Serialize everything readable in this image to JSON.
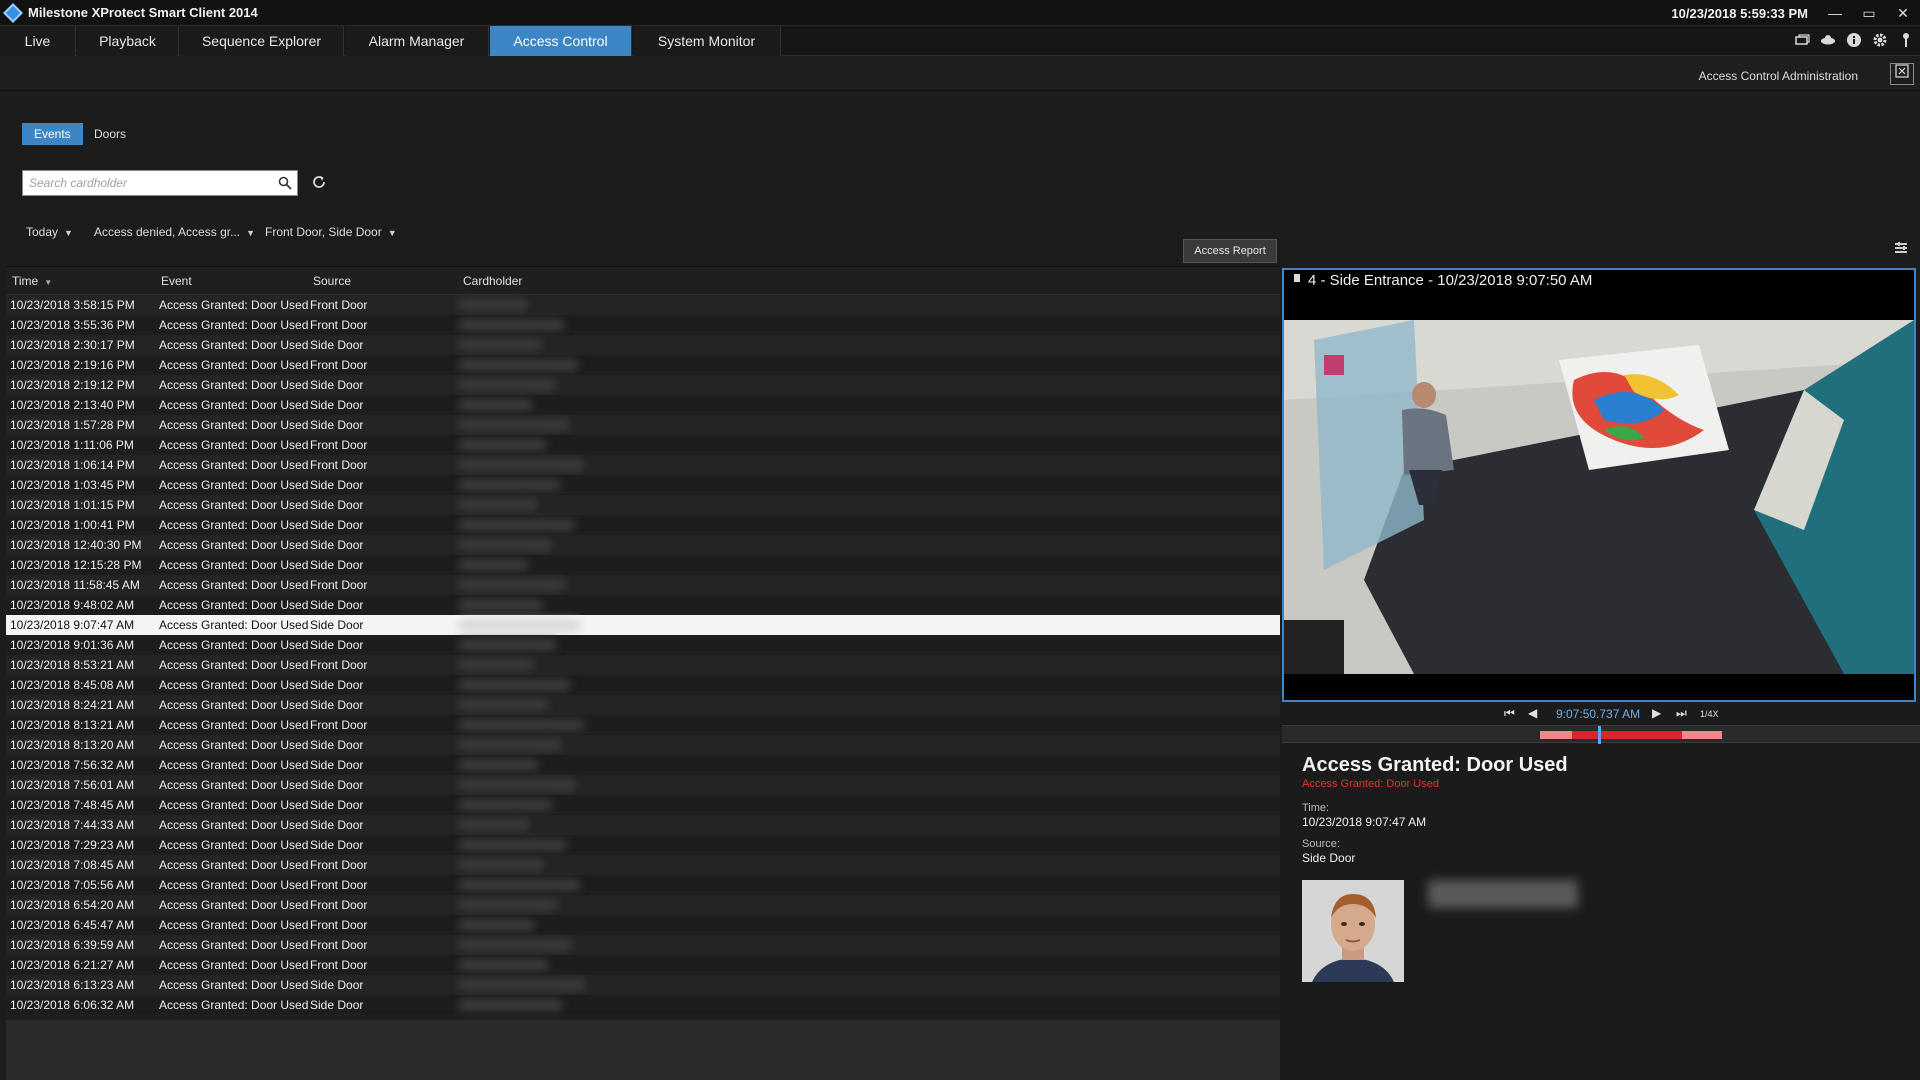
{
  "app": {
    "title": "Milestone XProtect Smart Client 2014",
    "clock": "10/23/2018 5:59:33 PM"
  },
  "window_controls": {
    "minimize": "—",
    "maximize": "▭",
    "close": "✕"
  },
  "main_tabs": [
    {
      "label": "Live",
      "active": false
    },
    {
      "label": "Playback",
      "active": false
    },
    {
      "label": "Sequence Explorer",
      "active": false
    },
    {
      "label": "Alarm Manager",
      "active": false
    },
    {
      "label": "Access Control",
      "active": true
    },
    {
      "label": "System Monitor",
      "active": false
    }
  ],
  "toolbar_icons": [
    "window-icon",
    "cloud-icon",
    "info-icon",
    "gear-icon",
    "pin-icon"
  ],
  "header": {
    "admin_label": "Access Control Administration"
  },
  "sub_tabs": [
    {
      "label": "Events",
      "active": true
    },
    {
      "label": "Doors",
      "active": false
    }
  ],
  "search": {
    "placeholder": "Search cardholder",
    "value": ""
  },
  "filters": [
    {
      "label": "Today"
    },
    {
      "label": "Access denied, Access gr..."
    },
    {
      "label": "Front Door, Side Door"
    }
  ],
  "report_button": "Access Report",
  "table": {
    "columns": [
      "Time",
      "Event",
      "Source",
      "Cardholder"
    ],
    "rows": [
      {
        "time": "10/23/2018 3:58:15 PM",
        "event": "Access Granted: Door Used",
        "source": "Front Door"
      },
      {
        "time": "10/23/2018 3:55:36 PM",
        "event": "Access Granted: Door Used",
        "source": "Front Door"
      },
      {
        "time": "10/23/2018 2:30:17 PM",
        "event": "Access Granted: Door Used",
        "source": "Side Door"
      },
      {
        "time": "10/23/2018 2:19:16 PM",
        "event": "Access Granted: Door Used",
        "source": "Front Door"
      },
      {
        "time": "10/23/2018 2:19:12 PM",
        "event": "Access Granted: Door Used",
        "source": "Side Door"
      },
      {
        "time": "10/23/2018 2:13:40 PM",
        "event": "Access Granted: Door Used",
        "source": "Side Door"
      },
      {
        "time": "10/23/2018 1:57:28 PM",
        "event": "Access Granted: Door Used",
        "source": "Side Door"
      },
      {
        "time": "10/23/2018 1:11:06 PM",
        "event": "Access Granted: Door Used",
        "source": "Front Door"
      },
      {
        "time": "10/23/2018 1:06:14 PM",
        "event": "Access Granted: Door Used",
        "source": "Front Door"
      },
      {
        "time": "10/23/2018 1:03:45 PM",
        "event": "Access Granted: Door Used",
        "source": "Side Door"
      },
      {
        "time": "10/23/2018 1:01:15 PM",
        "event": "Access Granted: Door Used",
        "source": "Side Door"
      },
      {
        "time": "10/23/2018 1:00:41 PM",
        "event": "Access Granted: Door Used",
        "source": "Side Door"
      },
      {
        "time": "10/23/2018 12:40:30 PM",
        "event": "Access Granted: Door Used",
        "source": "Side Door"
      },
      {
        "time": "10/23/2018 12:15:28 PM",
        "event": "Access Granted: Door Used",
        "source": "Side Door"
      },
      {
        "time": "10/23/2018 11:58:45 AM",
        "event": "Access Granted: Door Used",
        "source": "Front Door"
      },
      {
        "time": "10/23/2018 9:48:02 AM",
        "event": "Access Granted: Door Used",
        "source": "Side Door"
      },
      {
        "time": "10/23/2018 9:07:47 AM",
        "event": "Access Granted: Door Used",
        "source": "Side Door",
        "selected": true
      },
      {
        "time": "10/23/2018 9:01:36 AM",
        "event": "Access Granted: Door Used",
        "source": "Side Door"
      },
      {
        "time": "10/23/2018 8:53:21 AM",
        "event": "Access Granted: Door Used",
        "source": "Front Door"
      },
      {
        "time": "10/23/2018 8:45:08 AM",
        "event": "Access Granted: Door Used",
        "source": "Side Door"
      },
      {
        "time": "10/23/2018 8:24:21 AM",
        "event": "Access Granted: Door Used",
        "source": "Side Door"
      },
      {
        "time": "10/23/2018 8:13:21 AM",
        "event": "Access Granted: Door Used",
        "source": "Front Door"
      },
      {
        "time": "10/23/2018 8:13:20 AM",
        "event": "Access Granted: Door Used",
        "source": "Side Door"
      },
      {
        "time": "10/23/2018 7:56:32 AM",
        "event": "Access Granted: Door Used",
        "source": "Side Door"
      },
      {
        "time": "10/23/2018 7:56:01 AM",
        "event": "Access Granted: Door Used",
        "source": "Side Door"
      },
      {
        "time": "10/23/2018 7:48:45 AM",
        "event": "Access Granted: Door Used",
        "source": "Side Door"
      },
      {
        "time": "10/23/2018 7:44:33 AM",
        "event": "Access Granted: Door Used",
        "source": "Side Door"
      },
      {
        "time": "10/23/2018 7:29:23 AM",
        "event": "Access Granted: Door Used",
        "source": "Side Door"
      },
      {
        "time": "10/23/2018 7:08:45 AM",
        "event": "Access Granted: Door Used",
        "source": "Front Door"
      },
      {
        "time": "10/23/2018 7:05:56 AM",
        "event": "Access Granted: Door Used",
        "source": "Front Door"
      },
      {
        "time": "10/23/2018 6:54:20 AM",
        "event": "Access Granted: Door Used",
        "source": "Front Door"
      },
      {
        "time": "10/23/2018 6:45:47 AM",
        "event": "Access Granted: Door Used",
        "source": "Front Door"
      },
      {
        "time": "10/23/2018 6:39:59 AM",
        "event": "Access Granted: Door Used",
        "source": "Front Door"
      },
      {
        "time": "10/23/2018 6:21:27 AM",
        "event": "Access Granted: Door Used",
        "source": "Front Door"
      },
      {
        "time": "10/23/2018 6:13:23 AM",
        "event": "Access Granted: Door Used",
        "source": "Side Door"
      },
      {
        "time": "10/23/2018 6:06:32 AM",
        "event": "Access Granted: Door Used",
        "source": "Side Door"
      }
    ]
  },
  "video": {
    "title": "4 - Side Entrance - 10/23/2018 9:07:50 AM",
    "playback_time": "9:07:50.737 AM",
    "speed_label": "1/4X"
  },
  "details": {
    "title": "Access Granted: Door Used",
    "subtitle": "Access Granted: Door Used",
    "time_label": "Time:",
    "time_value": "10/23/2018 9:07:47 AM",
    "source_label": "Source:",
    "source_value": "Side Door"
  },
  "colors": {
    "accent": "#3d86c6",
    "alert_red": "#e0352b",
    "timeline_red": "#d8262e"
  }
}
